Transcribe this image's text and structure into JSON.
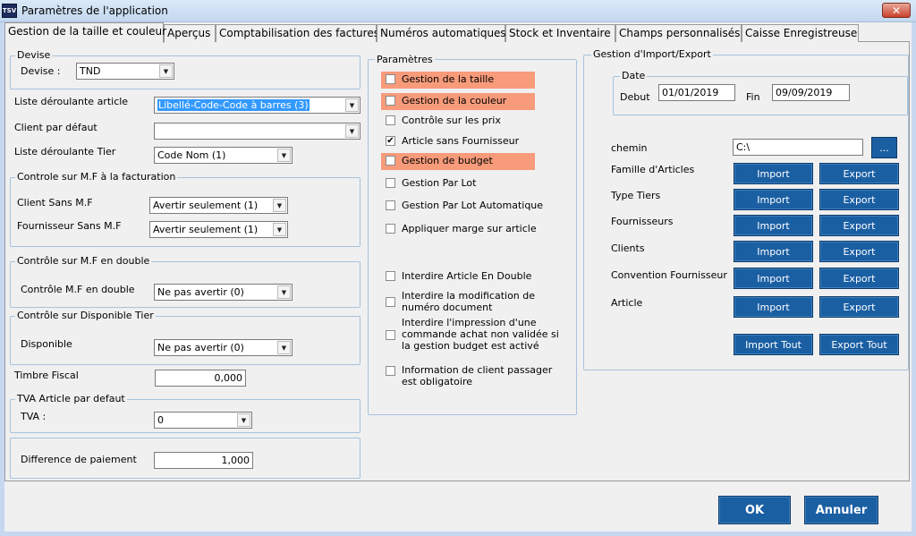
{
  "window": {
    "title": "Paramètres de l'application",
    "app_icon": "TSV",
    "close": "✕"
  },
  "tabs": [
    {
      "label": "Gestion de la taille et couleur",
      "active": true
    },
    {
      "label": "Aperçus"
    },
    {
      "label": "Comptabilisation des factures"
    },
    {
      "label": "Numéros automatiques"
    },
    {
      "label": "Stock et Inventaire"
    },
    {
      "label": "Champs personnalisés"
    },
    {
      "label": "Caisse Enregistreuse"
    }
  ],
  "left": {
    "devise": {
      "legend": "Devise",
      "label": "Devise :",
      "value": "TND"
    },
    "liste_article": {
      "label": "Liste déroulante article",
      "value": "Libellé-Code-Code à barres (3)"
    },
    "client_defaut": {
      "label": "Client par défaut",
      "value": ""
    },
    "liste_tier": {
      "label": "Liste déroulante Tier",
      "value": "Code Nom (1)"
    },
    "controle_mf": {
      "legend": "Controle sur M.F à la facturation",
      "client_label": "Client Sans M.F",
      "client_value": "Avertir seulement (1)",
      "fournisseur_label": "Fournisseur Sans M.F",
      "fournisseur_value": "Avertir seulement (1)"
    },
    "controle_double": {
      "legend": "Contrôle sur M.F en double",
      "label": "Contrôle M.F en double",
      "value": "Ne pas avertir (0)"
    },
    "controle_dispo": {
      "legend": "Contrôle sur Disponible Tier",
      "label": "Disponible",
      "value": "Ne pas avertir (0)"
    },
    "timbre": {
      "label": "Timbre Fiscal",
      "value": "0,000"
    },
    "tva": {
      "legend": "TVA Article par defaut",
      "label": "TVA :",
      "value": "0"
    },
    "difference": {
      "label": "Difference de paiement",
      "value": "1,000"
    }
  },
  "parametres": {
    "legend": "Paramètres",
    "items": [
      {
        "label": "Gestion de la taille",
        "checked": false,
        "highlight": true
      },
      {
        "label": "Gestion de la couleur",
        "checked": false,
        "highlight": true
      },
      {
        "label": "Contrôle sur les prix",
        "checked": false
      },
      {
        "label": "Article sans Fournisseur",
        "checked": true
      },
      {
        "label": "Gestion de budget",
        "checked": false,
        "highlight": true
      },
      {
        "label": "Gestion Par Lot",
        "checked": false
      },
      {
        "label": "Gestion Par Lot Automatique",
        "checked": false
      },
      {
        "label": "Appliquer marge sur article",
        "checked": false
      },
      {
        "label": "Interdire Article En Double",
        "checked": false
      },
      {
        "label": "Interdire la modification de numéro document",
        "checked": false
      },
      {
        "label": "Interdire l'impression d'une commande achat non validée si la gestion budget est activé",
        "checked": false
      },
      {
        "label": "Information de client passager est obligatoire",
        "checked": false
      }
    ],
    "highlight_color": "#f79b7b"
  },
  "import_export": {
    "legend": "Gestion d'Import/Export",
    "date_legend": "Date",
    "debut_label": "Debut",
    "debut_value": "01/01/2019",
    "fin_label": "Fin",
    "fin_value": "09/09/2019",
    "chemin_label": "chemin",
    "chemin_value": "C:\\",
    "browse": "...",
    "rows": [
      {
        "label": "Famille d'Articles"
      },
      {
        "label": "Type Tiers"
      },
      {
        "label": "Fournisseurs"
      },
      {
        "label": "Clients"
      },
      {
        "label": "Convention Fournisseur"
      },
      {
        "label": "Article"
      }
    ],
    "import_label": "Import",
    "export_label": "Export",
    "import_all": "Import Tout",
    "export_all": "Export Tout"
  },
  "footer": {
    "ok": "OK",
    "cancel": "Annuler"
  },
  "colors": {
    "button": "#1b5fa3",
    "group_border": "#a6c2de"
  }
}
